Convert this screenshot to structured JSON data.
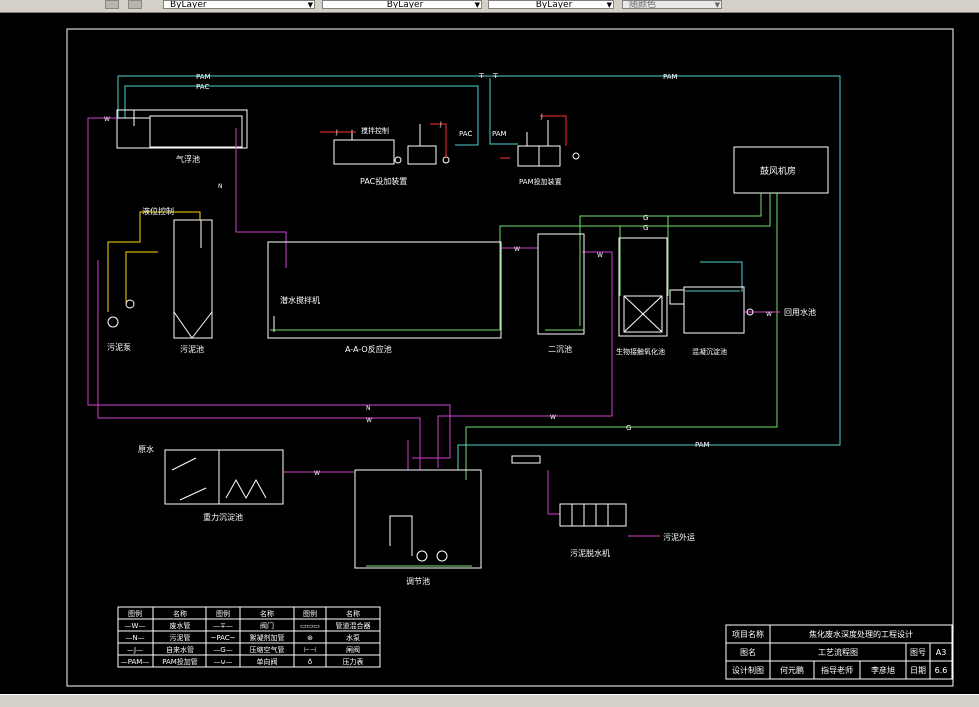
{
  "toolbar": {
    "linetype": "ByLayer",
    "lineweight": "ByLayer",
    "plotstyle": "ByLayer",
    "color_value": "随颜色"
  },
  "labels": {
    "pam": "PAM",
    "pac": "PAC",
    "w": "W",
    "n": "N",
    "g": "G",
    "j": "J",
    "flotation_tank": "气浮池",
    "level_control": "液位控制",
    "sludge_pump": "污泥泵",
    "sludge_tank": "污泥池",
    "stirring_tank": "搅拌控制",
    "pac_device": "PAC投加装置",
    "pam_device": "PAM投加装置",
    "blower_room": "鼓风机房",
    "submersible_mixer": "潜水搅拌机",
    "aao_tank": "A-A-O反应池",
    "secondary_clarifier": "二沉池",
    "bio_contact_tank": "生物接触氧化池",
    "coag_sed_tank": "混凝沉淀池",
    "reuse_tank": "回用水池",
    "raw_water": "原水",
    "gravity_grit": "重力沉淀池",
    "regulating_tank": "调节池",
    "sludge_dewater": "污泥脱水机",
    "sludge_out": "污泥外运"
  },
  "legend": {
    "headers": [
      "图例",
      "名称",
      "图例",
      "名称",
      "图例",
      "名称"
    ],
    "rows": [
      [
        "—W—",
        "废水管",
        "—∓—",
        "阀门",
        "▭▭▭",
        "管道混合器"
      ],
      [
        "—N—",
        "污泥管",
        "~PAC~",
        "絮凝剂加管",
        "⊛",
        "水泵"
      ],
      [
        "—J—",
        "自来水管",
        "—G—",
        "压缩空气管",
        "⊢⊣",
        "闸阀"
      ],
      [
        "—PAM—",
        "PAM投加管",
        "—⊍—",
        "单向阀",
        "♁",
        "压力表"
      ]
    ]
  },
  "title_block": {
    "project_label": "项目名称",
    "project_value": "焦化废水深度处理的工程设计",
    "drawing_label": "图名",
    "drawing_value": "工艺流程图",
    "no_label": "图号",
    "no_value": "A3",
    "design_label": "设计制图",
    "designer": "何元鹏",
    "advisor": "指导老师",
    "advisor_name": "李彦旭",
    "date_label": "日期",
    "date_value": "6.6"
  }
}
